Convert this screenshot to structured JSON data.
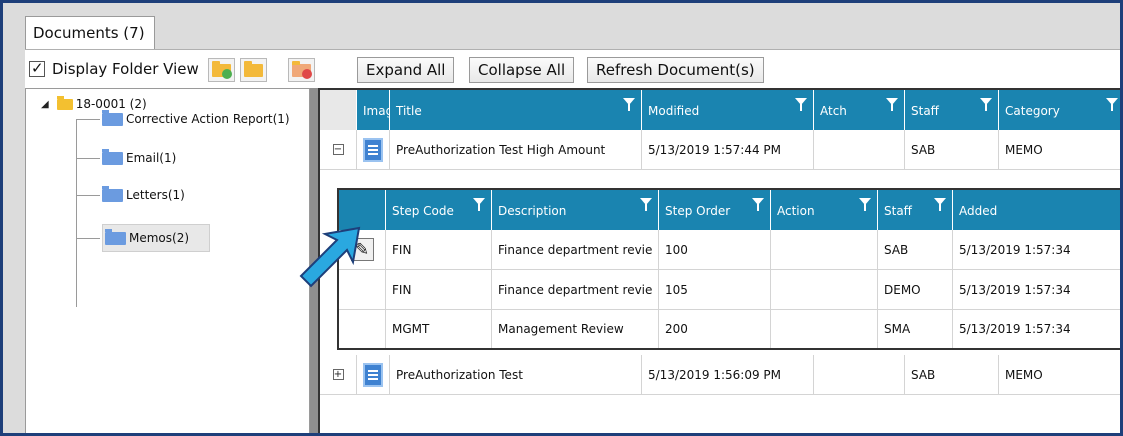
{
  "tab": {
    "label": "Documents (7)"
  },
  "toolbar": {
    "display_folder_view": "Display Folder View",
    "expand_all": "Expand All",
    "collapse_all": "Collapse All",
    "refresh": "Refresh Document(s)",
    "icons": [
      "add-folder-icon",
      "open-folder-icon",
      "delete-folder-icon"
    ]
  },
  "tree": {
    "root": "18-0001 (2)",
    "items": [
      "Corrective Action Report(1)",
      "Email(1)",
      "Letters(1)",
      "Memos(2)"
    ]
  },
  "grid": {
    "headers": [
      "Imag",
      "Title",
      "Modified",
      "Atch",
      "Staff",
      "Category"
    ],
    "rows": [
      {
        "expander": "−",
        "title": "PreAuthorization Test High Amount",
        "modified": "5/13/2019 1:57:44 PM",
        "atch": "",
        "staff": "SAB",
        "category": "MEMO"
      },
      {
        "expander": "+",
        "title": "PreAuthorization Test",
        "modified": "5/13/2019 1:56:09 PM",
        "atch": "",
        "staff": "SAB",
        "category": "MEMO"
      }
    ]
  },
  "detail": {
    "headers": [
      "Step Code",
      "Description",
      "Step Order",
      "Action",
      "Staff",
      "Added"
    ],
    "rows": [
      {
        "code": "FIN",
        "description": "Finance department revie",
        "order": "100",
        "action": "",
        "staff": "SAB",
        "added": "5/13/2019 1:57:34"
      },
      {
        "code": "FIN",
        "description": "Finance department revie",
        "order": "105",
        "action": "",
        "staff": "DEMO",
        "added": "5/13/2019 1:57:34"
      },
      {
        "code": "MGMT",
        "description": "Management Review",
        "order": "200",
        "action": "",
        "staff": "SMA",
        "added": "5/13/2019 1:57:34"
      }
    ]
  },
  "colors": {
    "header_blue": "#1a84b0",
    "frame_border": "#1e3f7a",
    "arrow_blue": "#2aa8e0"
  }
}
